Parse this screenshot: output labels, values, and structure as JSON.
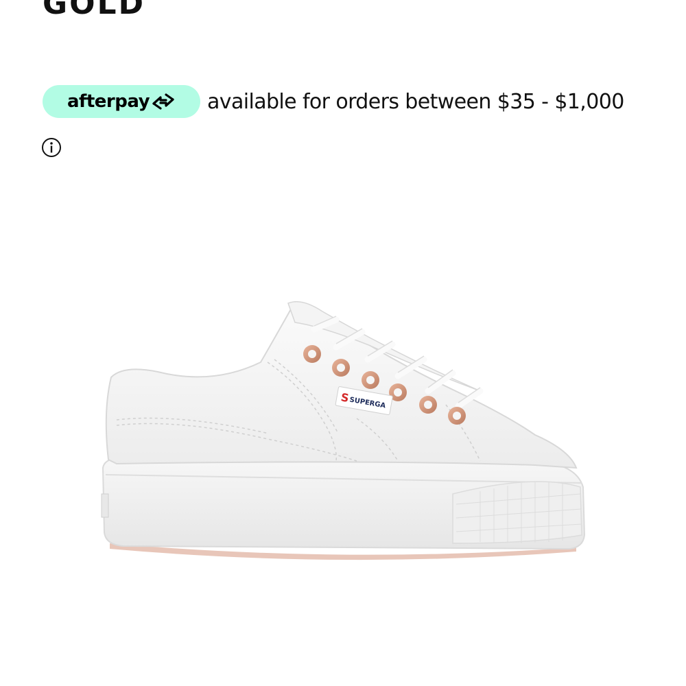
{
  "product": {
    "title": "GOLD",
    "brand_label": "SUPERGA"
  },
  "afterpay": {
    "logo_text": "afterpay",
    "message": "available for orders between $35 - $1,000",
    "badge_color": "#b2fce4"
  },
  "icons": {
    "info": "info-icon",
    "afterpay_arrows": "afterpay-arrows-icon"
  }
}
